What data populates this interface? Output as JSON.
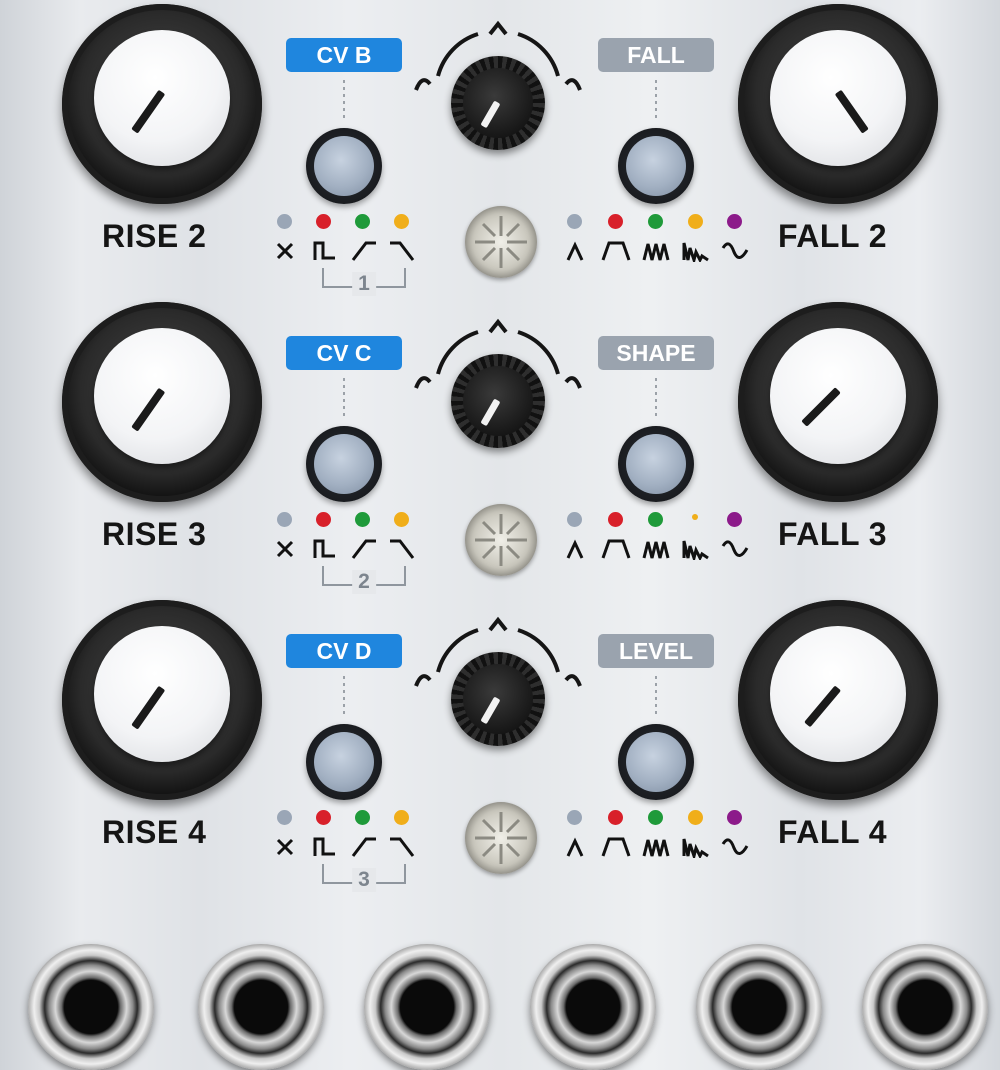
{
  "rows": [
    {
      "rise_label": "RISE 2",
      "fall_label": "FALL 2",
      "cv_tag": "CV B",
      "assign_tag": "FALL",
      "group_number": "1"
    },
    {
      "rise_label": "RISE 3",
      "fall_label": "FALL 3",
      "cv_tag": "CV C",
      "assign_tag": "SHAPE",
      "group_number": "2"
    },
    {
      "rise_label": "RISE 4",
      "fall_label": "FALL 4",
      "cv_tag": "CV D",
      "assign_tag": "LEVEL",
      "group_number": "3"
    }
  ],
  "colors": {
    "cv_tag_blue": "#1f86de",
    "assign_tag_grey": "#9aa3ae",
    "led_grey": "#9aa6b6",
    "led_red": "#d8202a",
    "led_green": "#1f9a3a",
    "led_yellow": "#f0ae1a",
    "led_purple": "#8c1a8a"
  },
  "left_mode_icons": [
    "x-icon",
    "pulse-icon",
    "rise-ramp-icon",
    "fall-ramp-icon"
  ],
  "right_mode_icons": [
    "peak-icon",
    "trapezoid-icon",
    "burst-icon",
    "decay-burst-icon",
    "sine-icon"
  ],
  "jack_count": 6
}
